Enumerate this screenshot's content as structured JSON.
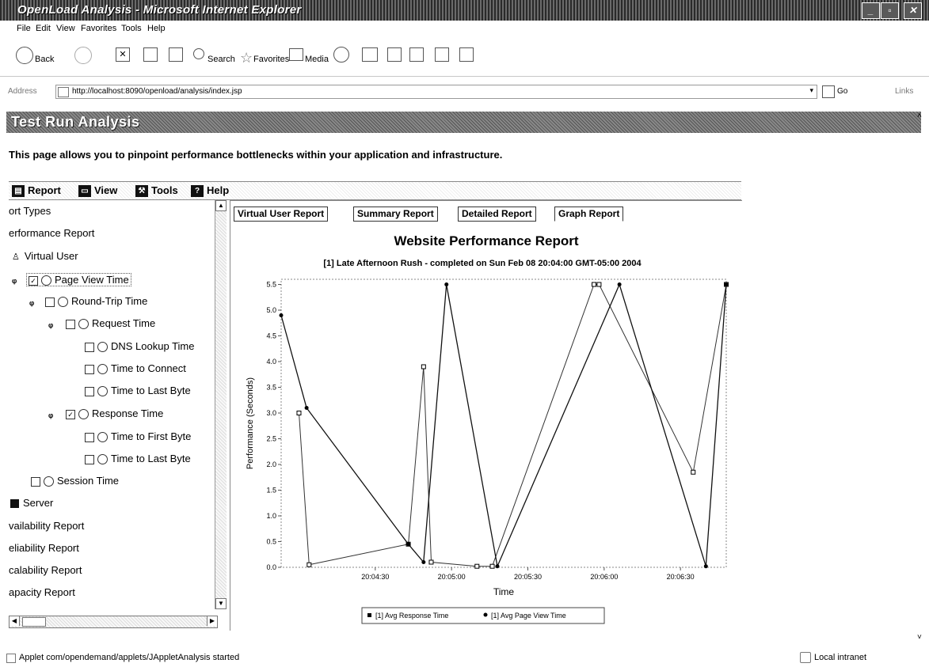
{
  "window": {
    "title": "OpenLoad Analysis - Microsoft Internet Explorer"
  },
  "menu": [
    "File",
    "Edit",
    "View",
    "Favorites",
    "Tools",
    "Help"
  ],
  "toolbar": {
    "back": "Back",
    "search": "Search",
    "favorites": "Favorites",
    "media": "Media"
  },
  "address": {
    "label": "Address",
    "url": "http://localhost:8090/openload/analysis/index.jsp",
    "go": "Go",
    "links": "Links"
  },
  "page": {
    "banner": "Test Run Analysis",
    "intro": "This page allows you to pinpoint performance bottlenecks within your application and infrastructure."
  },
  "applet_menu": [
    "Report",
    "View",
    "Tools",
    "Help"
  ],
  "tree": [
    {
      "label": "ort Types",
      "checked": null
    },
    {
      "label": "erformance Report",
      "checked": null
    },
    {
      "label": "Virtual User",
      "checked": null
    },
    {
      "label": "Page View Time",
      "checked": true
    },
    {
      "label": "Round-Trip Time",
      "checked": false
    },
    {
      "label": "Request Time",
      "checked": false
    },
    {
      "label": "DNS Lookup Time",
      "checked": false
    },
    {
      "label": "Time to Connect",
      "checked": false
    },
    {
      "label": "Time to Last Byte",
      "checked": false
    },
    {
      "label": "Response Time",
      "checked": true
    },
    {
      "label": "Time to First Byte",
      "checked": false
    },
    {
      "label": "Time to Last Byte",
      "checked": false
    },
    {
      "label": "Session Time",
      "checked": false
    },
    {
      "label": "Server",
      "checked": null
    },
    {
      "label": "vailability Report",
      "checked": null
    },
    {
      "label": "eliability Report",
      "checked": null
    },
    {
      "label": "calability Report",
      "checked": null
    },
    {
      "label": "apacity Report",
      "checked": null
    }
  ],
  "tabs": [
    "Virtual User Report",
    "Summary Report",
    "Detailed Report",
    "Graph Report"
  ],
  "status": {
    "text": "Applet com/opendemand/applets/JAppletAnalysis started",
    "zone": "Local intranet"
  },
  "chart_data": {
    "type": "line",
    "title": "Website Performance Report",
    "subtitle": "[1] Late Afternoon Rush - completed on Sun Feb 08 20:04:00 GMT-05:00 2004",
    "xlabel": "Time",
    "ylabel": "Performance (Seconds)",
    "x_ticks": [
      "20:04:30",
      "20:05:00",
      "20:05:30",
      "20:06:00",
      "20:06:30"
    ],
    "y_ticks": [
      "0.0",
      "0.5",
      "1.0",
      "1.5",
      "2.0",
      "2.5",
      "3.0",
      "3.5",
      "4.0",
      "4.5",
      "5.0",
      "5.5"
    ],
    "ylim": [
      0,
      5.6
    ],
    "xlim_seconds_after_20_04_00": [
      -7,
      168
    ],
    "series": [
      {
        "name": "[1] Avg Response Time",
        "marker": "square",
        "x": [
          0,
          4,
          43,
          49,
          52,
          70,
          76,
          116,
          118,
          155,
          168
        ],
        "y": [
          3.0,
          0.05,
          0.45,
          3.9,
          0.1,
          0.02,
          0.02,
          5.5,
          5.5,
          1.85,
          5.5
        ]
      },
      {
        "name": "[1] Avg Page View Time",
        "marker": "circle",
        "x": [
          -7,
          3,
          43,
          49,
          58,
          78,
          126,
          160,
          168
        ],
        "y": [
          4.9,
          3.1,
          0.45,
          0.1,
          5.5,
          0.02,
          5.5,
          0.02,
          5.5
        ]
      }
    ],
    "grid": false,
    "legend": "bottom"
  }
}
